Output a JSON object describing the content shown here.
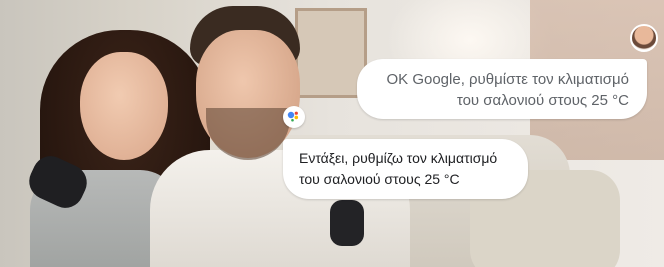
{
  "conversation": {
    "user_message": {
      "line1": "OK Google, ρυθμίστε τον κλιματισμό",
      "line2": "του σαλονιού στους 25 °C"
    },
    "assistant_message": {
      "line1": "Εντάξει, ρυθμίζω τον κλιματισμό",
      "line2": "του σαλονιού στους 25 °C"
    }
  },
  "icons": {
    "assistant": "google-assistant-icon",
    "user": "user-avatar"
  },
  "colors": {
    "bubble_background": "#ffffff",
    "user_text": "#5f6368",
    "assistant_text": "#202124",
    "assistant_dot_blue": "#4285f4",
    "assistant_dot_red": "#ea4335",
    "assistant_dot_yellow": "#fbbc05",
    "assistant_dot_green": "#34a853"
  }
}
